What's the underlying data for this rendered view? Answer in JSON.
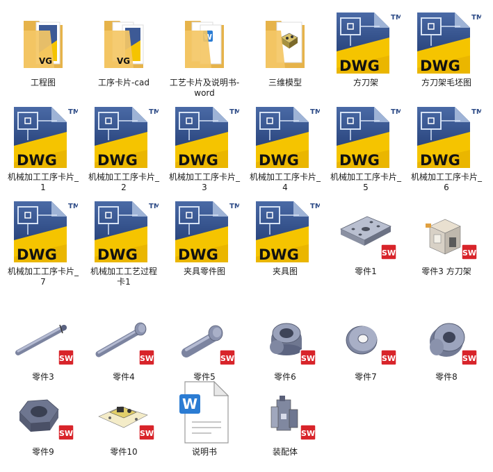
{
  "items": [
    {
      "name": "工程图",
      "type": "folder-vg"
    },
    {
      "name": "工序卡片-cad",
      "type": "folder-vg2"
    },
    {
      "name": "工艺卡片及说明书-word",
      "type": "folder-word"
    },
    {
      "name": "三维模型",
      "type": "folder-model"
    },
    {
      "name": "方刀架",
      "type": "dwg"
    },
    {
      "name": "方刀架毛坯图",
      "type": "dwg"
    },
    {
      "name": "机械加工工序卡片_1",
      "type": "dwg"
    },
    {
      "name": "机械加工工序卡片_2",
      "type": "dwg"
    },
    {
      "name": "机械加工工序卡片_3",
      "type": "dwg"
    },
    {
      "name": "机械加工工序卡片_4",
      "type": "dwg"
    },
    {
      "name": "机械加工工序卡片_5",
      "type": "dwg"
    },
    {
      "name": "机械加工工序卡片_6",
      "type": "dwg"
    },
    {
      "name": "机械加工工序卡片_7",
      "type": "dwg"
    },
    {
      "name": "机械加工工艺过程卡1",
      "type": "dwg"
    },
    {
      "name": "夹具零件图",
      "type": "dwg"
    },
    {
      "name": "夹具图",
      "type": "dwg"
    },
    {
      "name": "零件1",
      "type": "sw-plate"
    },
    {
      "name": "零件3 方刀架",
      "type": "sw-block"
    },
    {
      "name": "零件3",
      "type": "sw-rod"
    },
    {
      "name": "零件4",
      "type": "sw-bolt"
    },
    {
      "name": "零件5",
      "type": "sw-pin"
    },
    {
      "name": "零件6",
      "type": "sw-bushing"
    },
    {
      "name": "零件7",
      "type": "sw-washer"
    },
    {
      "name": "零件8",
      "type": "sw-ring"
    },
    {
      "name": "零件9",
      "type": "sw-nut"
    },
    {
      "name": "零件10",
      "type": "sw-assembly-flat"
    },
    {
      "name": "说明书",
      "type": "word-doc"
    },
    {
      "name": "装配体",
      "type": "sw-assembly"
    }
  ],
  "colors": {
    "dwg_yellow": "#f5c400",
    "dwg_blue": "#2c4a86",
    "folder": "#f4c765",
    "sw_red": "#d8242a",
    "word_blue": "#2b7cd3"
  },
  "text": {
    "dwg": "DWG",
    "tm": "TM",
    "vg": "VG",
    "sw": "SW",
    "word_w": "W"
  }
}
